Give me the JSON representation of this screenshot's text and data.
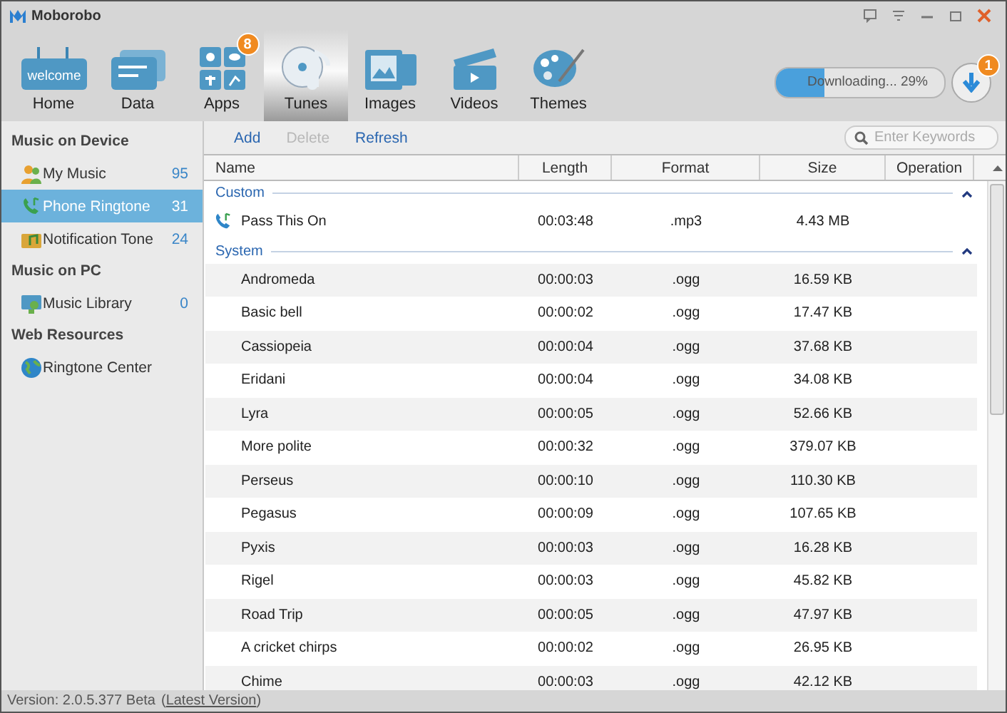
{
  "window": {
    "title": "Moborobo"
  },
  "nav": [
    {
      "label": "Home",
      "selected": false
    },
    {
      "label": "Data",
      "selected": false
    },
    {
      "label": "Apps",
      "selected": false,
      "badge": "8"
    },
    {
      "label": "Tunes",
      "selected": true
    },
    {
      "label": "Images",
      "selected": false
    },
    {
      "label": "Videos",
      "selected": false
    },
    {
      "label": "Themes",
      "selected": false
    }
  ],
  "home_icon_text": "welcome",
  "download": {
    "label": "Downloading... 29%",
    "level": 0.29,
    "badge": "1"
  },
  "sidebar": [
    {
      "heading": "Music on Device",
      "items": [
        {
          "label": "My Music",
          "count": "95",
          "selected": false
        },
        {
          "label": "Phone Ringtone",
          "count": "31",
          "selected": true
        },
        {
          "label": "Notification Tone",
          "count": "24",
          "selected": false
        }
      ]
    },
    {
      "heading": "Music on PC",
      "items": [
        {
          "label": "Music Library",
          "count": "0",
          "selected": false
        }
      ]
    },
    {
      "heading": "Web Resources",
      "items": [
        {
          "label": "Ringtone Center",
          "selected": false
        }
      ]
    }
  ],
  "actions": [
    {
      "label": "Add",
      "disabled": false
    },
    {
      "label": "Delete",
      "disabled": true
    },
    {
      "label": "Refresh",
      "disabled": false
    }
  ],
  "search": {
    "placeholder": "Enter Keywords"
  },
  "table": {
    "columns": [
      "Name",
      "Length",
      "Format",
      "Size",
      "Operation"
    ],
    "sections": [
      {
        "title": "Custom",
        "expanded": true,
        "rows": [
          {
            "name": "Pass This On",
            "length": "00:03:48",
            "format": ".mp3",
            "size": "4.43 MB"
          }
        ]
      },
      {
        "title": "System",
        "expanded": true,
        "rows": [
          {
            "name": "Andromeda",
            "length": "00:00:03",
            "format": ".ogg",
            "size": "16.59 KB"
          },
          {
            "name": "Basic bell",
            "length": "00:00:02",
            "format": ".ogg",
            "size": "17.47 KB"
          },
          {
            "name": "Cassiopeia",
            "length": "00:00:04",
            "format": ".ogg",
            "size": "37.68 KB"
          },
          {
            "name": "Eridani",
            "length": "00:00:04",
            "format": ".ogg",
            "size": "34.08 KB"
          },
          {
            "name": "Lyra",
            "length": "00:00:05",
            "format": ".ogg",
            "size": "52.66 KB"
          },
          {
            "name": "More polite",
            "length": "00:00:32",
            "format": ".ogg",
            "size": "379.07 KB"
          },
          {
            "name": "Perseus",
            "length": "00:00:10",
            "format": ".ogg",
            "size": "110.30 KB"
          },
          {
            "name": "Pegasus",
            "length": "00:00:09",
            "format": ".ogg",
            "size": "107.65 KB"
          },
          {
            "name": "Pyxis",
            "length": "00:00:03",
            "format": ".ogg",
            "size": "16.28 KB"
          },
          {
            "name": "Rigel",
            "length": "00:00:03",
            "format": ".ogg",
            "size": "45.82 KB"
          },
          {
            "name": "Road Trip",
            "length": "00:00:05",
            "format": ".ogg",
            "size": "47.97 KB"
          },
          {
            "name": "A cricket chirps",
            "length": "00:00:02",
            "format": ".ogg",
            "size": "26.95 KB"
          },
          {
            "name": "Chime",
            "length": "00:00:03",
            "format": ".ogg",
            "size": "42.12 KB"
          }
        ]
      }
    ]
  },
  "status_bar": {
    "version": "Version: 2.0.5.377 Beta",
    "link_open": "(",
    "link": "Latest Version",
    "link_close": ")"
  }
}
